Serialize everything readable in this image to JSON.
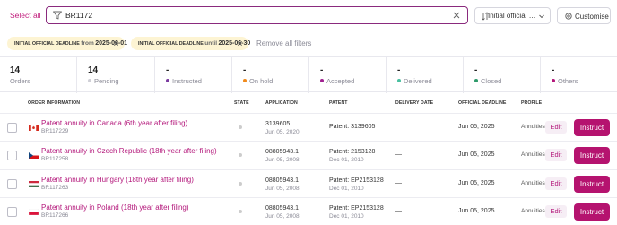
{
  "toolbar": {
    "select_all": "Select all",
    "search_value": "BR1172",
    "sort_label": "Initial official de...",
    "customise_label": "Customise"
  },
  "filters": [
    {
      "key": "INITIAL OFFICIAL DEADLINE",
      "mode": "from",
      "date": "2025-06-01"
    },
    {
      "key": "INITIAL OFFICIAL DEADLINE",
      "mode": "until",
      "date": "2025-06-30"
    }
  ],
  "remove_all": "Remove all filters",
  "stats": [
    {
      "count": "14",
      "label": "Orders",
      "dot": null
    },
    {
      "count": "14",
      "label": "Pending",
      "dot": "#cfcfd6"
    },
    {
      "count": "-",
      "label": "Instructed",
      "dot": "#7a3aa0"
    },
    {
      "count": "-",
      "label": "On hold",
      "dot": "#f08a1c"
    },
    {
      "count": "-",
      "label": "Accepted",
      "dot": "#a02090"
    },
    {
      "count": "-",
      "label": "Delivered",
      "dot": "#49c0a0"
    },
    {
      "count": "-",
      "label": "Closed",
      "dot": "#2e9a6a"
    },
    {
      "count": "-",
      "label": "Others",
      "dot": "#b3167a"
    }
  ],
  "columns": {
    "order": "ORDER INFORMATION",
    "state": "STATE",
    "application": "APPLICATION",
    "patent": "PATENT",
    "delivery": "DELIVERY DATE",
    "deadline": "OFFICIAL DEADLINE",
    "profile": "PROFILE"
  },
  "rows": [
    {
      "flag": "canada",
      "title": "Patent annuity in Canada (6th year after filing)",
      "ref": "BR117229",
      "app_no": "3139605",
      "app_date": "Jun 05, 2020",
      "patent": "Patent: 3139605",
      "patent_date": "",
      "delivery": "",
      "deadline": "Jun 05, 2025",
      "profile": "Annuities",
      "edit": "Edit",
      "instruct": "Instruct"
    },
    {
      "flag": "czech",
      "title": "Patent annuity in Czech Republic (18th year after filing)",
      "ref": "BR117258",
      "app_no": "08805943.1",
      "app_date": "Jun 05, 2008",
      "patent": "Patent: 2153128",
      "patent_date": "Dec 01, 2010",
      "delivery": "—",
      "deadline": "Jun 05, 2025",
      "profile": "Annuities",
      "edit": "Edit",
      "instruct": "Instruct"
    },
    {
      "flag": "hungary",
      "title": "Patent annuity in Hungary (18th year after filing)",
      "ref": "BR117263",
      "app_no": "08805943.1",
      "app_date": "Jun 05, 2008",
      "patent": "Patent: EP2153128",
      "patent_date": "Dec 01, 2010",
      "delivery": "—",
      "deadline": "Jun 05, 2025",
      "profile": "Annuities",
      "edit": "Edit",
      "instruct": "Instruct"
    },
    {
      "flag": "poland",
      "title": "Patent annuity in Poland (18th year after filing)",
      "ref": "BR117266",
      "app_no": "08805943.1",
      "app_date": "Jun 05, 2008",
      "patent": "Patent: EP2153128",
      "patent_date": "Dec 01, 2010",
      "delivery": "—",
      "deadline": "Jun 05, 2025",
      "profile": "Annuities",
      "edit": "Edit",
      "instruct": "Instruct"
    }
  ]
}
